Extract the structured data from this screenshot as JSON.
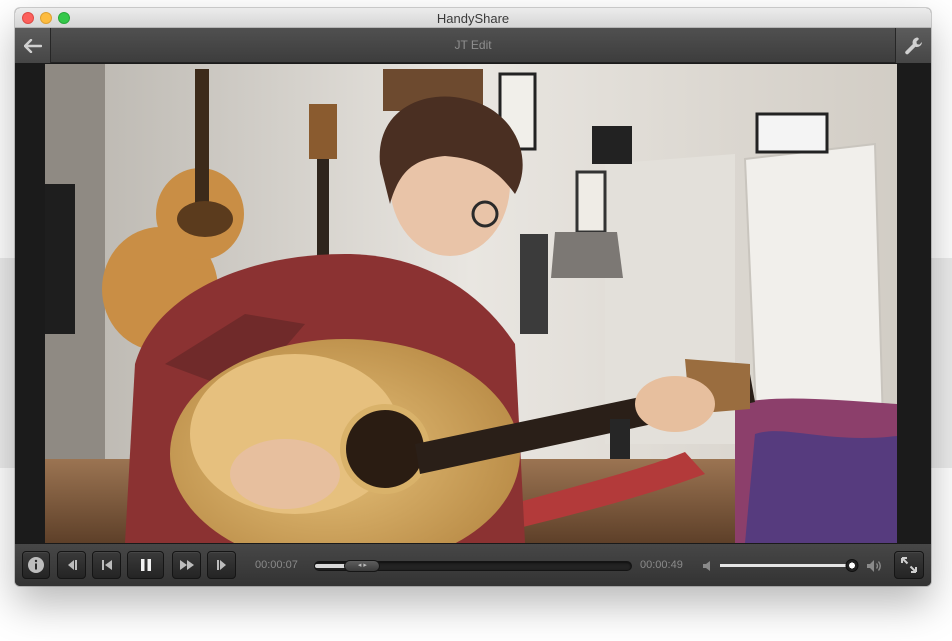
{
  "window": {
    "title": "HandyShare"
  },
  "navbar": {
    "title": "JT Edit",
    "back_icon": "arrow-left-icon",
    "settings_icon": "wrench-icon"
  },
  "player": {
    "current_time": "00:00:07",
    "total_time": "00:00:49",
    "progress": 0.15,
    "volume": 0.98,
    "state": "playing"
  },
  "controls": {
    "info_icon": "info-icon",
    "step_back_icon": "step-back-icon",
    "skip_start_icon": "skip-to-start-icon",
    "pause_icon": "pause-icon",
    "fast_forward_icon": "fast-forward-icon",
    "step_forward_icon": "step-forward-icon",
    "volume_low_icon": "volume-low-icon",
    "volume_high_icon": "volume-high-icon",
    "fullscreen_icon": "fullscreen-icon",
    "seek_handle_glyph": "◂ ▸"
  },
  "video": {
    "description_icon": "video-frame"
  },
  "colors": {
    "bar_dark": "#333333",
    "accent_light": "#d8d8d8"
  }
}
